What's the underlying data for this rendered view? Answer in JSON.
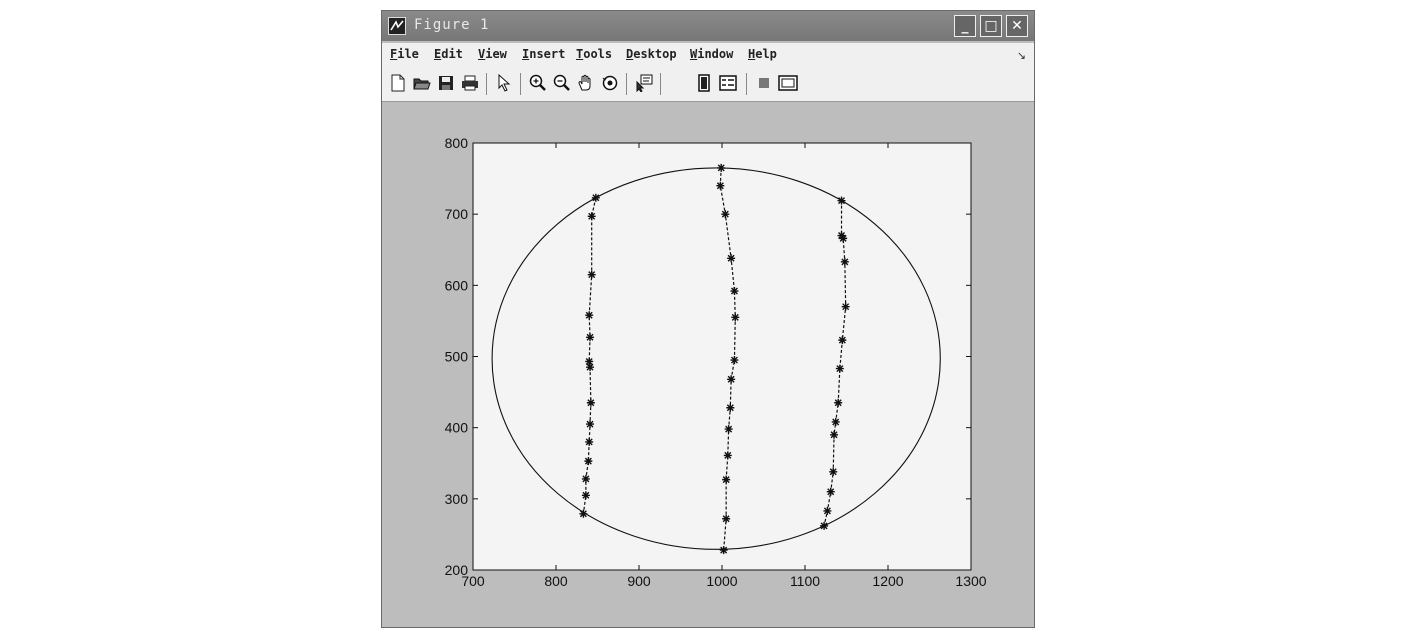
{
  "window": {
    "title": "Figure 1",
    "minimize_label": "_",
    "maximize_label": "□",
    "close_label": "✕"
  },
  "menu": {
    "items": [
      {
        "key": "F",
        "rest": "ile"
      },
      {
        "key": "E",
        "rest": "dit"
      },
      {
        "key": "V",
        "rest": "iew"
      },
      {
        "key": "I",
        "rest": "nsert"
      },
      {
        "key": "T",
        "rest": "ools"
      },
      {
        "key": "D",
        "rest": "esktop"
      },
      {
        "key": "W",
        "rest": "indow"
      },
      {
        "key": "H",
        "rest": "elp"
      }
    ],
    "dock_arrow": "↘"
  },
  "toolbar": {
    "icons": [
      "new-file-icon",
      "open-folder-icon",
      "save-icon",
      "print-icon",
      "select-arrow-icon",
      "zoom-in-icon",
      "zoom-out-icon",
      "pan-hand-icon",
      "rotate-3d-icon",
      "data-cursor-icon",
      "colorbar-icon",
      "legend-icon",
      "hide-plot-tools-icon",
      "show-plot-tools-icon"
    ]
  },
  "chart_data": {
    "type": "scatter",
    "title": "",
    "xlabel": "",
    "ylabel": "",
    "xlim": [
      700,
      1300
    ],
    "ylim": [
      200,
      800
    ],
    "xticks": [
      700,
      800,
      900,
      1000,
      1100,
      1200,
      1300
    ],
    "yticks": [
      200,
      300,
      400,
      500,
      600,
      700,
      800
    ],
    "grid": false,
    "circle": {
      "cx": 993,
      "cy": 497,
      "rx": 270,
      "ry": 268
    },
    "series": [
      {
        "style": "dashed-line-with-star-markers",
        "points": [
          [
            848,
            723
          ],
          [
            843,
            697
          ],
          [
            843,
            615
          ],
          [
            840,
            558
          ],
          [
            841,
            527
          ],
          [
            840,
            493
          ],
          [
            841,
            485
          ],
          [
            842,
            435
          ],
          [
            841,
            405
          ],
          [
            840,
            380
          ],
          [
            839,
            353
          ],
          [
            836,
            328
          ],
          [
            836,
            305
          ],
          [
            833,
            279
          ]
        ]
      },
      {
        "style": "dashed-line-with-star-markers",
        "points": [
          [
            999,
            765
          ],
          [
            998,
            740
          ],
          [
            1004,
            700
          ],
          [
            1011,
            638
          ],
          [
            1015,
            592
          ],
          [
            1016,
            555
          ],
          [
            1015,
            495
          ],
          [
            1011,
            468
          ],
          [
            1010,
            428
          ],
          [
            1008,
            398
          ],
          [
            1007,
            361
          ],
          [
            1005,
            327
          ],
          [
            1005,
            272
          ],
          [
            1002,
            228
          ]
        ]
      },
      {
        "style": "dashed-line-with-star-markers",
        "points": [
          [
            1144,
            719
          ],
          [
            1144,
            670
          ],
          [
            1146,
            666
          ],
          [
            1148,
            633
          ],
          [
            1149,
            570
          ],
          [
            1145,
            523
          ],
          [
            1142,
            483
          ],
          [
            1140,
            435
          ],
          [
            1137,
            408
          ],
          [
            1135,
            390
          ],
          [
            1134,
            338
          ],
          [
            1131,
            310
          ],
          [
            1127,
            283
          ],
          [
            1123,
            262
          ]
        ]
      }
    ]
  }
}
